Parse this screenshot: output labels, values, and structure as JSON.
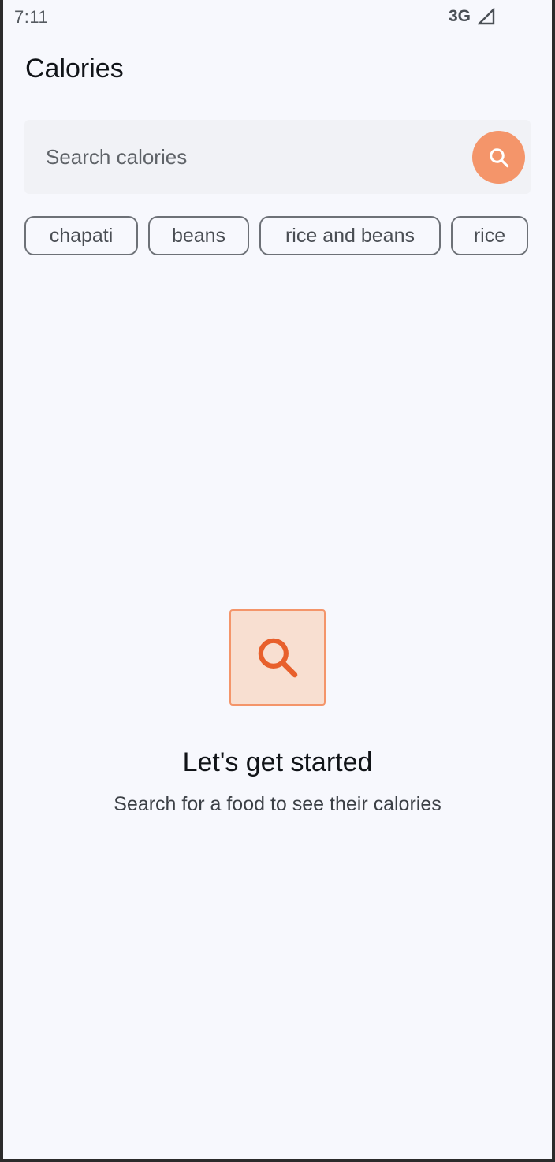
{
  "status_bar": {
    "time": "7:11",
    "network": "3G",
    "signal_icon": "cellular-signal-icon"
  },
  "header": {
    "title": "Calories"
  },
  "search": {
    "placeholder": "Search calories",
    "value": "",
    "button_icon": "search-icon",
    "button_color": "#f4956a"
  },
  "suggestions": [
    {
      "label": "chapati"
    },
    {
      "label": "beans"
    },
    {
      "label": "rice and beans"
    },
    {
      "label": "rice"
    }
  ],
  "empty_state": {
    "icon": "search-icon",
    "icon_color": "#e8602c",
    "icon_background": "#f8dfd1",
    "title": "Let's get started",
    "subtitle": "Search for a food to see their calories"
  }
}
